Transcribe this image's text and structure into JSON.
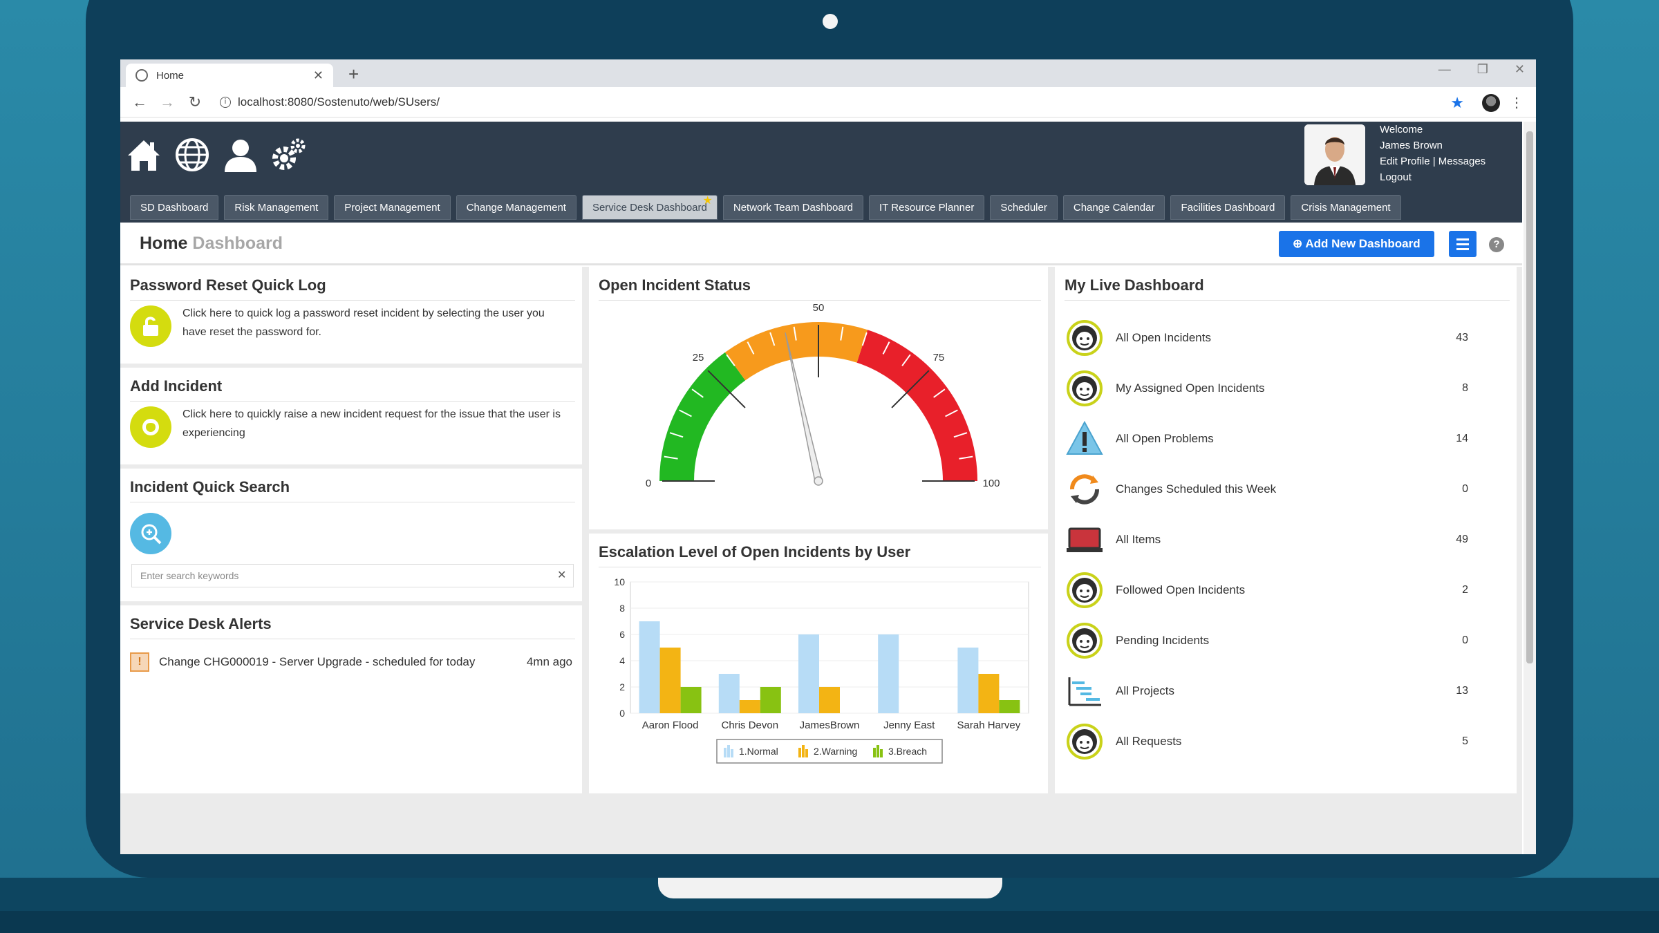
{
  "browser": {
    "tab_title": "Home",
    "new_tab": "+",
    "url": "localhost:8080/Sostenuto/web/SUsers/"
  },
  "user": {
    "welcome": "Welcome",
    "name": "James Brown",
    "edit_profile": "Edit Profile",
    "separator": "|",
    "messages": "Messages",
    "logout": "Logout"
  },
  "nav_tabs": [
    {
      "label": "SD Dashboard"
    },
    {
      "label": "Risk Management"
    },
    {
      "label": "Project Management"
    },
    {
      "label": "Change Management"
    },
    {
      "label": "Service Desk Dashboard",
      "active": true
    },
    {
      "label": "Network Team Dashboard"
    },
    {
      "label": "IT Resource Planner"
    },
    {
      "label": "Scheduler"
    },
    {
      "label": "Change Calendar"
    },
    {
      "label": "Facilities Dashboard"
    },
    {
      "label": "Crisis Management"
    }
  ],
  "title": {
    "main": "Home",
    "sub": "Dashboard",
    "add_button": "Add New Dashboard"
  },
  "password_reset": {
    "title": "Password Reset Quick Log",
    "text": "Click here to quick log a password reset incident by selecting the user you have reset the password for."
  },
  "add_incident": {
    "title": "Add Incident",
    "text": "Click here to quickly raise a new incident request for the issue that the user is experiencing"
  },
  "quick_search": {
    "title": "Incident Quick Search",
    "placeholder": "Enter search keywords"
  },
  "alerts": {
    "title": "Service Desk Alerts",
    "items": [
      {
        "text": "Change CHG000019 - Server Upgrade - scheduled for today",
        "time": "4mn ago"
      }
    ]
  },
  "gauge": {
    "title": "Open Incident Status",
    "min": 0,
    "max": 100,
    "value": 43,
    "ticks": [
      "0",
      "25",
      "50",
      "75",
      "100"
    ],
    "colors": {
      "green": "#22b822",
      "orange": "#f79a1c",
      "red": "#e8202a"
    }
  },
  "escalation": {
    "title": "Escalation Level of Open Incidents by User"
  },
  "chart_data": {
    "type": "bar",
    "title": "Escalation Level of Open Incidents by User",
    "categories": [
      "Aaron Flood",
      "Chris Devon",
      "JamesBrown",
      "Jenny East",
      "Sarah Harvey"
    ],
    "series": [
      {
        "name": "1.Normal",
        "color": "#b7dcf6",
        "values": [
          7,
          3,
          6,
          6,
          5
        ]
      },
      {
        "name": "2.Warning",
        "color": "#f3b414",
        "values": [
          5,
          1,
          2,
          0,
          3
        ]
      },
      {
        "name": "3.Breach",
        "color": "#88c212",
        "values": [
          2,
          2,
          0,
          0,
          1
        ]
      }
    ],
    "yticks": [
      "0",
      "2",
      "4",
      "6",
      "8",
      "10"
    ],
    "ylim": [
      0,
      10
    ],
    "legend": "bottom"
  },
  "live": {
    "title": "My Live Dashboard",
    "items": [
      {
        "label": "All Open Incidents",
        "count": "43",
        "icon": "agent"
      },
      {
        "label": "My Assigned Open Incidents",
        "count": "8",
        "icon": "agent"
      },
      {
        "label": "All Open Problems",
        "count": "14",
        "icon": "warning"
      },
      {
        "label": "Changes Scheduled this Week",
        "count": "0",
        "icon": "refresh"
      },
      {
        "label": "All Items",
        "count": "49",
        "icon": "laptop"
      },
      {
        "label": "Followed Open Incidents",
        "count": "2",
        "icon": "agent"
      },
      {
        "label": "Pending Incidents",
        "count": "0",
        "icon": "agent"
      },
      {
        "label": "All Projects",
        "count": "13",
        "icon": "gantt"
      },
      {
        "label": "All Requests",
        "count": "5",
        "icon": "agent"
      }
    ]
  }
}
